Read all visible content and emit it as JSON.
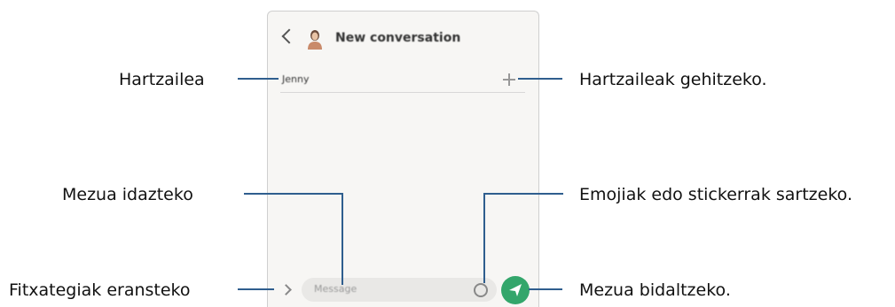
{
  "phone": {
    "title": "New conversation",
    "recipient": "Jenny",
    "message_placeholder": "Message"
  },
  "callouts": {
    "recipient": "Hartzailea",
    "add_recipients": "Hartzaileak gehitzeko.",
    "enter_message": "Mezua idazteko",
    "emoji_stickers": "Emojiak edo stickerrak sartzeko.",
    "attach_files": "Fitxategiak eransteko",
    "send_message": "Mezua bidaltzeko."
  },
  "colors": {
    "leader_line": "#2f5e8e",
    "send_button": "#33a66b"
  }
}
